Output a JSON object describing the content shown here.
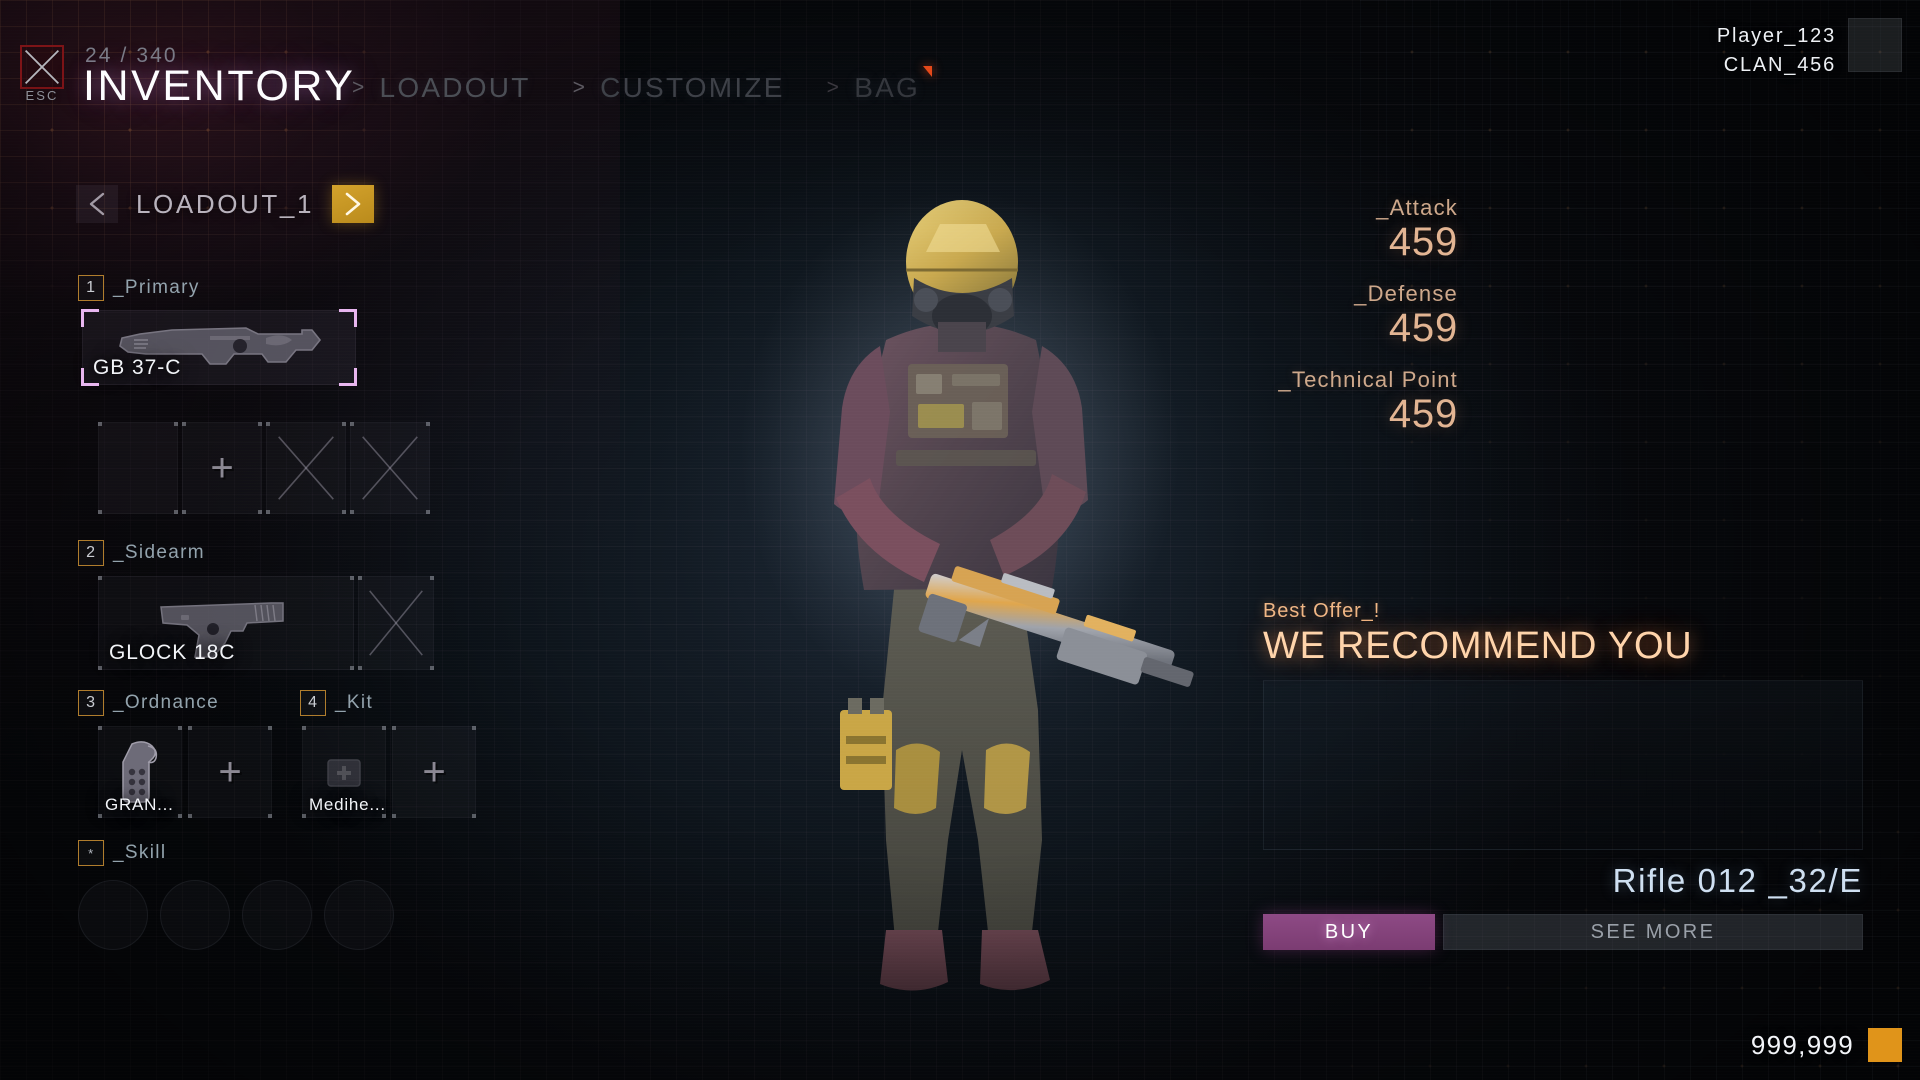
{
  "header": {
    "esc_label": "ESC",
    "esc_icon": "close-x-icon",
    "count": "24 / 340",
    "title": "INVENTORY",
    "tabs": [
      {
        "chevron": ">",
        "label": "LOADOUT",
        "notif": false
      },
      {
        "chevron": ">",
        "label": "CUSTOMIZE",
        "notif": false
      },
      {
        "chevron": ">",
        "label": "BAG",
        "notif": true
      }
    ]
  },
  "player": {
    "name": "Player_123",
    "clan": "CLAN_456"
  },
  "loadout": {
    "prev_icon": "chevron-left-icon",
    "next_icon": "chevron-right-icon",
    "name": "LOADOUT_1"
  },
  "slots": {
    "primary": {
      "key": "1",
      "label": "_Primary",
      "item_name": "GB 37-C",
      "icon": "assault-rifle-icon",
      "attachments": [
        {
          "type": "empty"
        },
        {
          "type": "add",
          "icon": "plus-icon"
        },
        {
          "type": "locked",
          "icon": "x-icon"
        },
        {
          "type": "locked",
          "icon": "x-icon"
        }
      ]
    },
    "sidearm": {
      "key": "2",
      "label": "_Sidearm",
      "item_name": "GLOCK 18C",
      "icon": "pistol-icon",
      "attachments": [
        {
          "type": "locked",
          "icon": "x-icon"
        }
      ]
    },
    "ordnance": {
      "key": "3",
      "label": "_Ordnance",
      "items": [
        {
          "type": "filled",
          "name": "GRAN...",
          "icon": "grenade-icon"
        },
        {
          "type": "add",
          "icon": "plus-icon"
        }
      ]
    },
    "kit": {
      "key": "4",
      "label": "_Kit",
      "items": [
        {
          "type": "filled",
          "name": "Medihe...",
          "icon": "medkit-icon"
        },
        {
          "type": "add",
          "icon": "plus-icon"
        }
      ]
    },
    "skill": {
      "key": "*",
      "label": "_Skill",
      "circles": 4
    }
  },
  "stats": [
    {
      "label": "_Attack",
      "value": "459"
    },
    {
      "label": "_Defense",
      "value": "459"
    },
    {
      "label": "_Technical Point",
      "value": "459"
    }
  ],
  "recommend": {
    "kicker": "Best Offer_!",
    "title": "WE RECOMMEND YOU",
    "item_name": "Rifle 012 _32/E",
    "buy_label": "BUY",
    "see_more_label": "SEE MORE"
  },
  "currency": {
    "amount": "999,999",
    "icon": "currency-block-icon"
  },
  "colors": {
    "accent_gold": "#d3a22c",
    "accent_purple": "#8e4a85",
    "stat_tan": "#e3b593",
    "reco_orange": "#ffd4ab",
    "currency": "#e0941a",
    "bracket_pink": "#e8b6ef",
    "esc_red": "#7d1417",
    "notif_red": "#e4491a"
  }
}
